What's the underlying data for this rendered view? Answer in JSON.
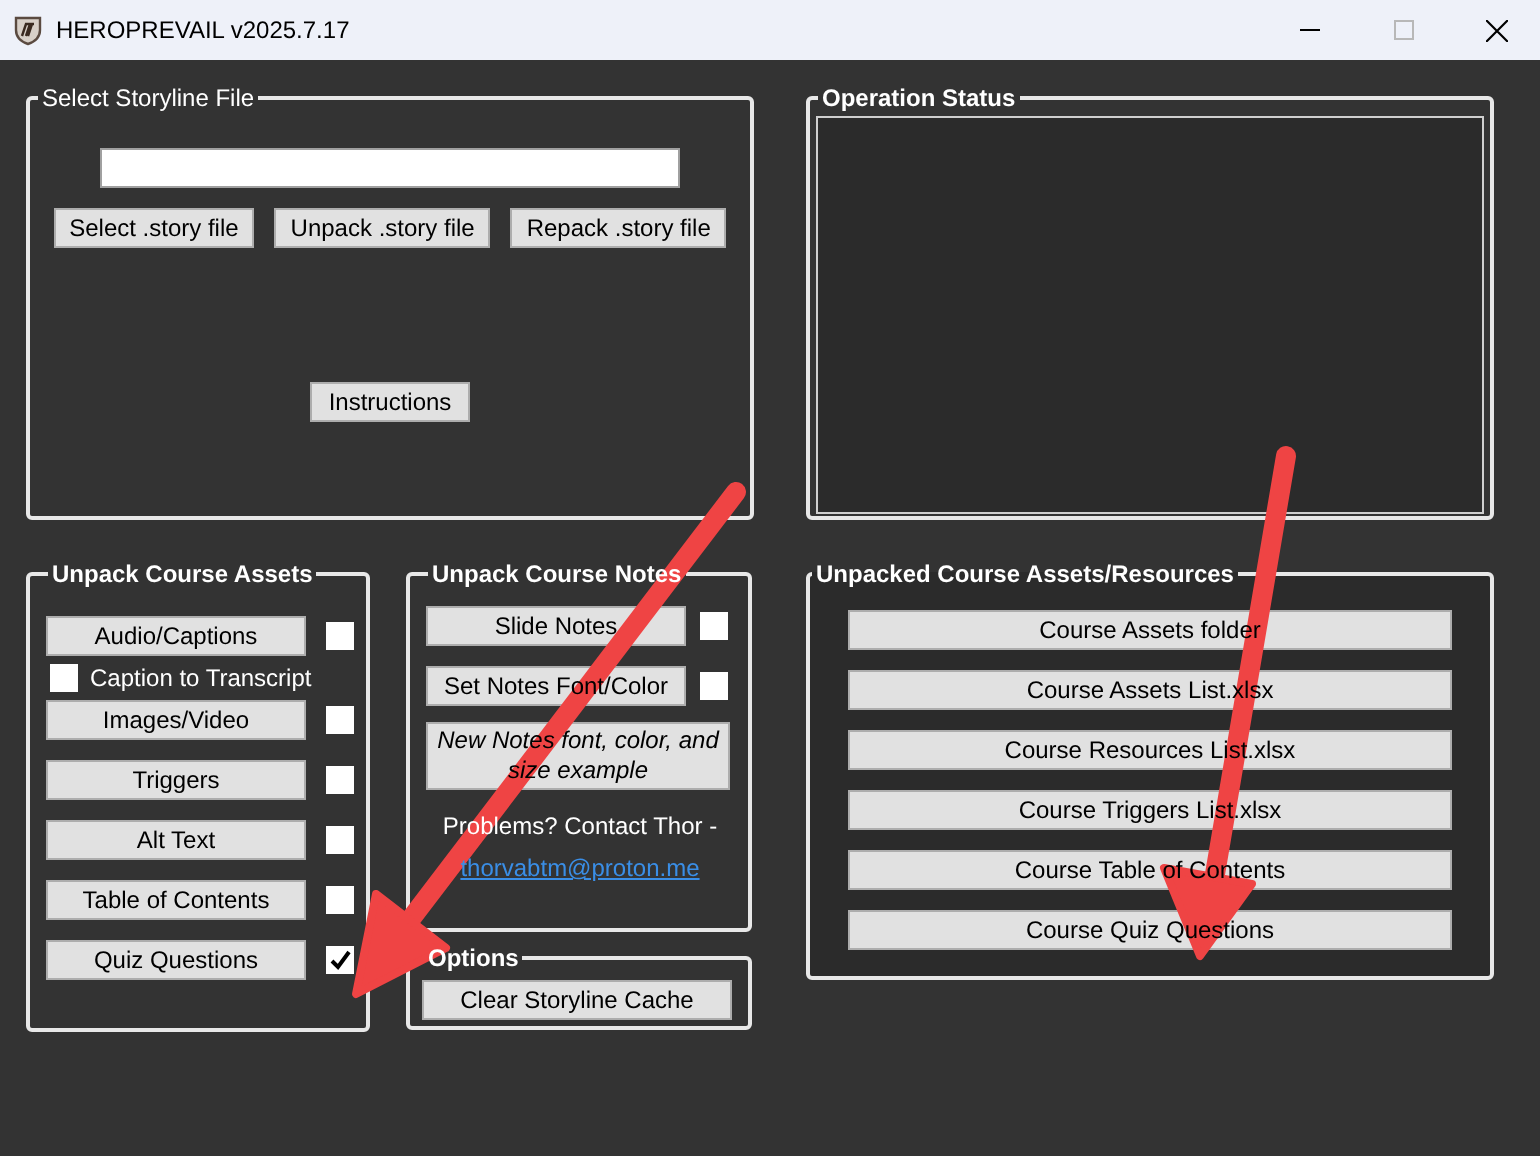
{
  "window": {
    "title": "HEROPREVAIL v2025.7.17"
  },
  "select_storyline_file": {
    "title": "Select Storyline File",
    "buttons": [
      "Select .story file",
      "Unpack .story file",
      "Repack .story file"
    ],
    "instructions_button": "Instructions"
  },
  "operation_status": {
    "title": "Operation Status"
  },
  "unpack_course_assets": {
    "title": "Unpack Course Assets",
    "items": [
      {
        "kind": "button",
        "label": "Audio/Captions",
        "checked": false
      },
      {
        "kind": "checkbox",
        "label": "Caption to Transcript",
        "checked": false
      },
      {
        "kind": "button",
        "label": "Images/Video",
        "checked": false
      },
      {
        "kind": "button",
        "label": "Triggers",
        "checked": false
      },
      {
        "kind": "button",
        "label": "Alt Text",
        "checked": false
      },
      {
        "kind": "button",
        "label": "Table of Contents",
        "checked": false
      },
      {
        "kind": "button",
        "label": "Quiz Questions",
        "checked": true
      }
    ]
  },
  "unpack_course_notes": {
    "title": "Unpack Course Notes",
    "items": [
      {
        "label": "Slide Notes",
        "checked": false
      },
      {
        "label": "Set Notes Font/Color",
        "checked": false
      }
    ],
    "font_example": "New Notes font, color, and size example",
    "contact": "Problems? Contact Thor -",
    "email": "thorvabtm@proton.me"
  },
  "options": {
    "title": "Options",
    "buttons": [
      "Clear Storyline Cache"
    ]
  },
  "unpacked_resources": {
    "title": "Unpacked Course Assets/Resources",
    "buttons": [
      "Course Assets folder",
      "Course Assets List.xlsx",
      "Course Resources List.xlsx",
      "Course Triggers List.xlsx",
      "Course Table of Contents",
      "Course Quiz Questions"
    ]
  }
}
